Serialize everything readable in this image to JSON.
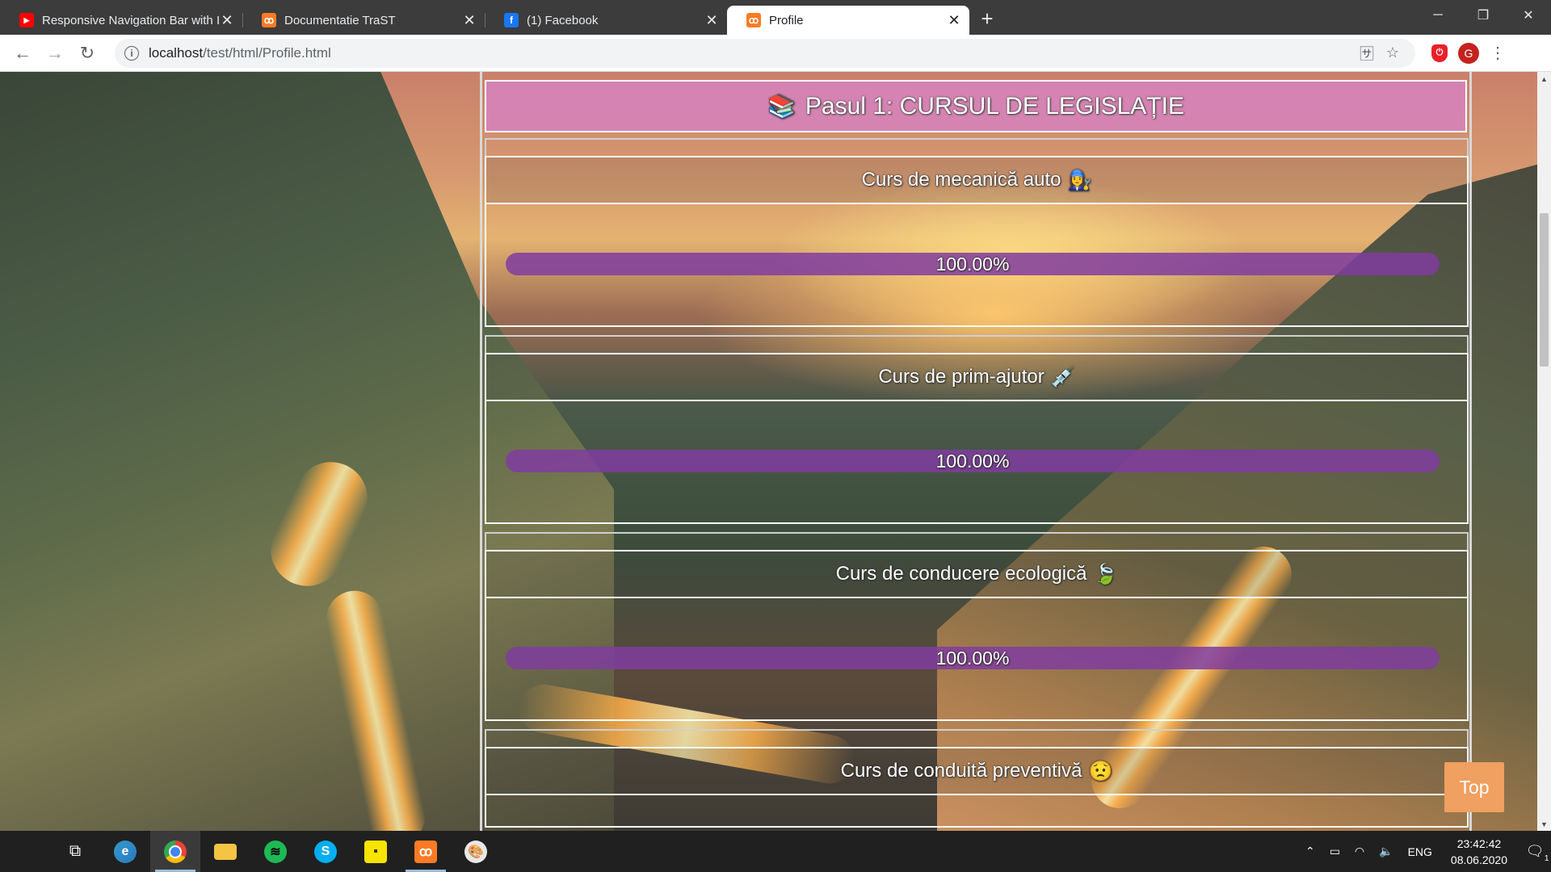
{
  "browser": {
    "tabs": [
      {
        "title": "Responsive Navigation Bar with I",
        "favicon": "youtube-icon",
        "active": false
      },
      {
        "title": "Documentatie TraST",
        "favicon": "xampp-icon",
        "active": false
      },
      {
        "title": "(1) Facebook",
        "favicon": "facebook-icon",
        "active": false
      },
      {
        "title": "Profile",
        "favicon": "xampp-icon",
        "active": true
      }
    ],
    "new_tab_label": "+",
    "url_host": "localhost",
    "url_path": "/test/html/Profile.html"
  },
  "page": {
    "step_title": "Pasul 1: CURSUL DE LEGISLAȚIE",
    "step_icon": "📚",
    "courses": [
      {
        "title": "Curs de mecanică auto",
        "emoji": "👩‍🔧",
        "progress_label": "100.00%",
        "progress": 1.0
      },
      {
        "title": "Curs de prim-ajutor",
        "emoji": "💉",
        "progress_label": "100.00%",
        "progress": 1.0
      },
      {
        "title": "Curs de conducere ecologică",
        "emoji": "🍃",
        "progress_label": "100.00%",
        "progress": 1.0
      },
      {
        "title": "Curs de conduită preventivă",
        "emoji": "😟"
      }
    ],
    "top_button": "Top"
  },
  "taskbar": {
    "apps": [
      "start-icon",
      "task-view-icon",
      "edge-icon",
      "chrome-icon",
      "file-explorer-icon",
      "spotify-icon",
      "skype-icon",
      "sticky-notes-icon",
      "xampp-icon",
      "paint-icon"
    ],
    "language": "ENG",
    "time": "23:42:42",
    "date": "08.06.2020",
    "notification_count": "1"
  },
  "colors": {
    "header_pink": "#d682be",
    "progress_purple": "#823ca0",
    "top_button": "#f0a060",
    "tab_bar": "#3c3c3c"
  }
}
